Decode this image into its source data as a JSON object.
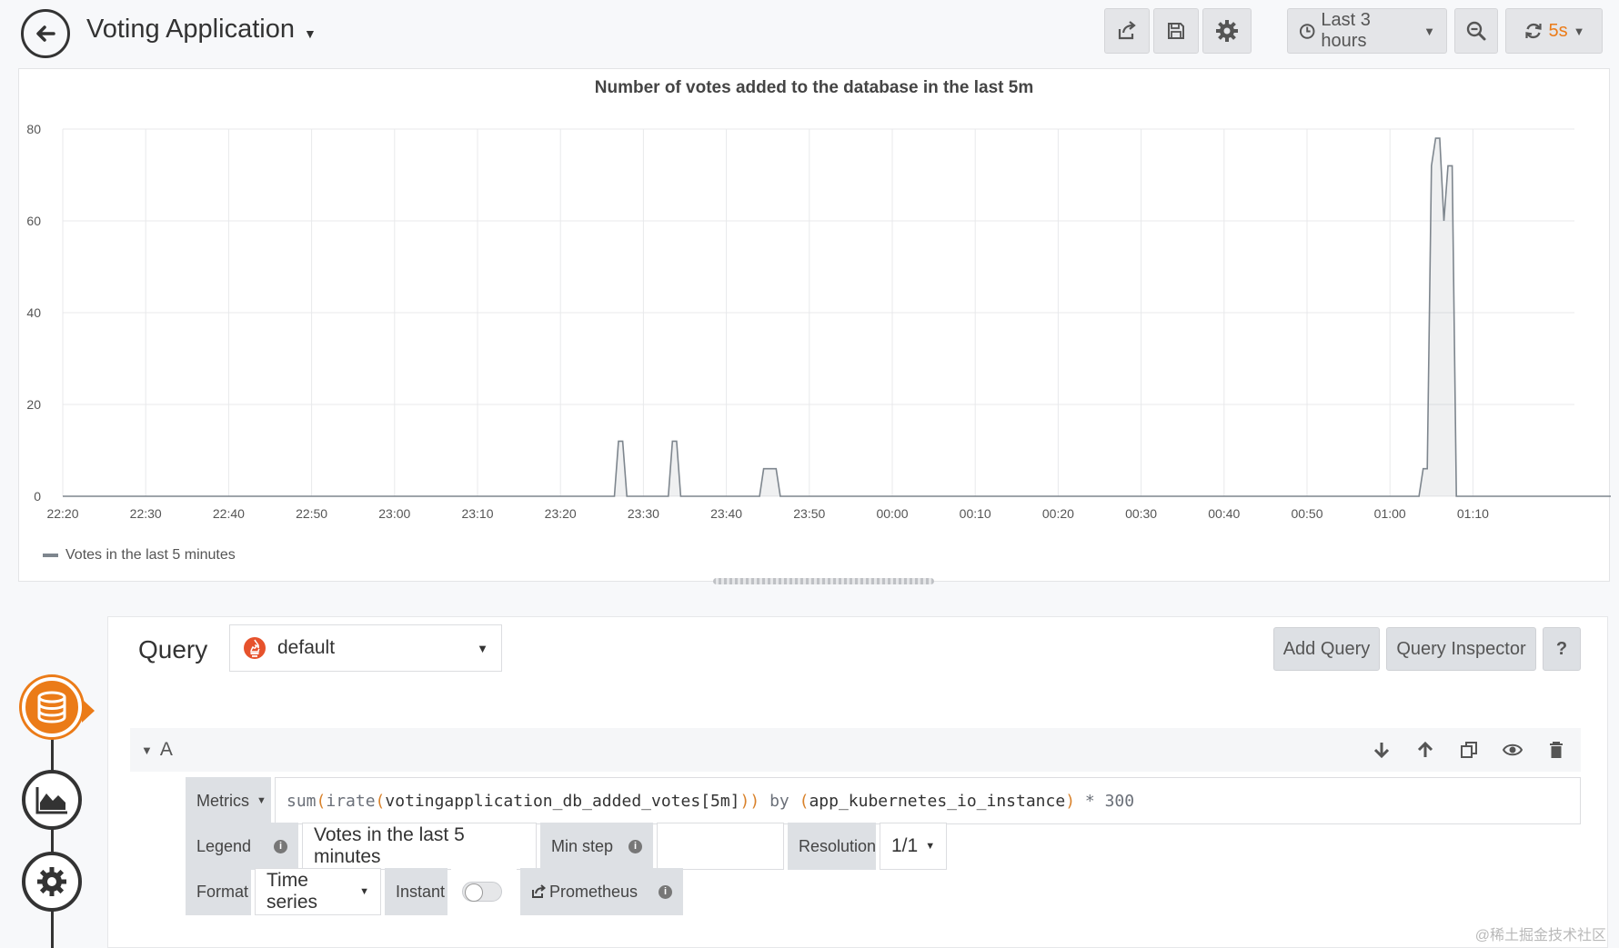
{
  "dashboard": {
    "title": "Voting Application"
  },
  "toolbar": {
    "time_range": "Last 3 hours",
    "refresh_interval": "5s"
  },
  "panel": {
    "title": "Number of votes added to the database in the last 5m",
    "legend": "Votes in the last 5 minutes"
  },
  "chart_data": {
    "type": "area",
    "title": "Number of votes added to the database in the last 5m",
    "x": [
      "22:20",
      "22:30",
      "22:40",
      "22:50",
      "23:00",
      "23:10",
      "23:20",
      "23:30",
      "23:40",
      "23:50",
      "00:00",
      "00:10",
      "00:20",
      "00:30",
      "00:40",
      "00:50",
      "01:00",
      "01:10"
    ],
    "xlabel": "",
    "ylabel": "",
    "ylim": [
      0,
      80
    ],
    "yticks": [
      0,
      20,
      40,
      60,
      80
    ],
    "grid": true,
    "legend_position": "bottom-left",
    "series": [
      {
        "name": "Votes in the last 5 minutes",
        "color": "#7e868e",
        "points": [
          [
            "22:20",
            0
          ],
          [
            "23:26.5",
            0
          ],
          [
            "23:27",
            12
          ],
          [
            "23:27.5",
            12
          ],
          [
            "23:28",
            0
          ],
          [
            "23:33",
            0
          ],
          [
            "23:33.5",
            12
          ],
          [
            "23:34",
            12
          ],
          [
            "23:34.5",
            0
          ],
          [
            "23:44",
            0
          ],
          [
            "23:44.5",
            6
          ],
          [
            "23:46",
            6
          ],
          [
            "23:46.5",
            0
          ],
          [
            "01:03.5",
            0
          ],
          [
            "01:04",
            6
          ],
          [
            "01:04.5",
            6
          ],
          [
            "01:05",
            72
          ],
          [
            "01:05.5",
            78
          ],
          [
            "01:06",
            78
          ],
          [
            "01:06.5",
            60
          ],
          [
            "01:07",
            72
          ],
          [
            "01:07.5",
            72
          ],
          [
            "01:08",
            0
          ],
          [
            "01:29",
            0
          ]
        ]
      }
    ]
  },
  "editor": {
    "query_label": "Query",
    "datasource": "default",
    "add_query": "Add Query",
    "query_inspector": "Query Inspector",
    "help": "?",
    "row_ref": "A",
    "metrics_label": "Metrics",
    "metrics_expr": {
      "fn1": "sum",
      "fn2": "irate",
      "metric": "votingapplication_db_added_votes",
      "range": "[5m]",
      "by_kw": "by",
      "label": "app_kubernetes_io_instance",
      "mult": "* 300"
    },
    "legend_label": "Legend",
    "legend_value": "Votes in the last 5 minutes",
    "min_step_label": "Min step",
    "min_step_value": "",
    "resolution_label": "Resolution",
    "resolution_value": "1/1",
    "format_label": "Format",
    "format_value": "Time series",
    "instant_label": "Instant",
    "prometheus_link": "Prometheus"
  },
  "watermark": "@稀土掘金技术社区",
  "colors": {
    "accent": "#eb7b18",
    "series": "#7e868e",
    "button_bg": "#e4e5e8"
  }
}
